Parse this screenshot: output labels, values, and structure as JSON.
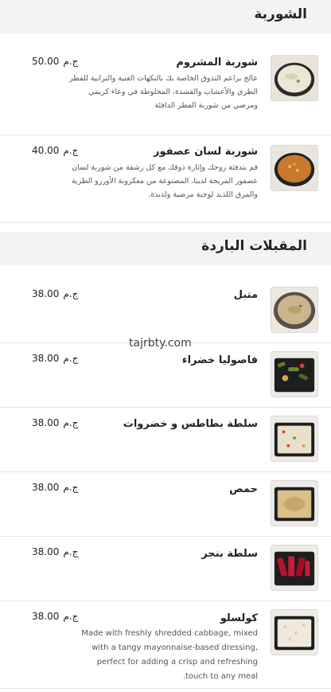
{
  "sections": [
    {
      "title": "الشوربة",
      "items": [
        {
          "name": "شوربة المشروم",
          "description": "عالج براعم التذوق الخاصة بك بالنكهات الغنية والترابية للفطر الطري والأعشاب والقشدة، المخلوطة في وعاء كريمي ومرضي من شوربة الفطر الدافئة",
          "price": "50.00",
          "currency": "ج.م"
        },
        {
          "name": "شوربة لسان عصفور",
          "description": "قم بتدفئة روحك وإثارة ذوقك مع كل رشفة من شوربة لسان عصفور المريحة لدينا، المصنوعة من معكرونة الأورزو الطرية والمرق اللذيذ لوجبة مرضية ولذيذة.",
          "price": "40.00",
          "currency": "ج.م"
        }
      ]
    },
    {
      "title": "المقبلات الباردة",
      "items": [
        {
          "name": "متبل",
          "price": "38.00",
          "currency": "ج.م"
        },
        {
          "name": "فاصوليا خضراء",
          "price": "38.00",
          "currency": "ج.م"
        },
        {
          "name": "سلطة بطاطس و خضروات",
          "price": "38.00",
          "currency": "ج.م"
        },
        {
          "name": "حمص",
          "price": "38.00",
          "currency": "ج.م"
        },
        {
          "name": "سلطة بنجر",
          "price": "38.00",
          "currency": "ج.م"
        },
        {
          "name": "كولسلو",
          "description": "Made with freshly shredded cabbage, mixed with a tangy mayonnaise-based dressing, perfect for adding a crisp and refreshing touch to any meal.",
          "price": "38.00",
          "currency": "ج.م"
        }
      ]
    }
  ],
  "watermark": "tajrbty.com"
}
